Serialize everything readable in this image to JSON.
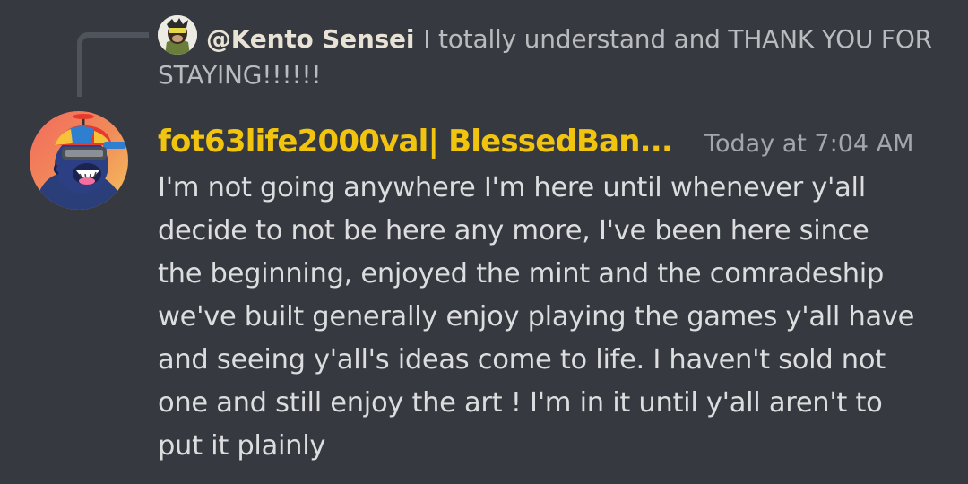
{
  "reply": {
    "author": "@Kento Sensei",
    "text": "I totally understand and THANK YOU FOR STAYING!!!!!!",
    "avatar_icon": "ape-avatar-icon"
  },
  "message": {
    "author": "fot63life2000val| BlessedBan...",
    "timestamp": "Today at 7:04 AM",
    "author_color": "#f1c40f",
    "avatar_icon": "gorilla-propeller-hat-avatar",
    "lines": [
      "I'm not going anywhere I'm here until whenever y'all",
      "decide to not be here any more, I've been here since",
      "the beginning, enjoyed the mint and the comradeship",
      "we've built generally enjoy playing the games y'all have",
      "and seeing y'all's ideas come to life. I haven't sold not",
      "one and still enjoy the art ! I'm in it until y'all aren't to",
      "put it plainly"
    ]
  }
}
